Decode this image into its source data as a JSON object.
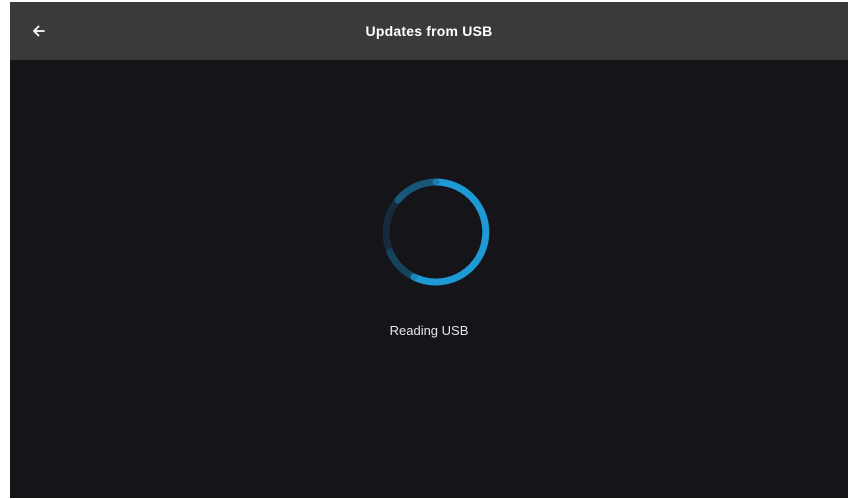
{
  "header": {
    "title": "Updates from USB",
    "back_icon": "arrow-left-icon"
  },
  "loading": {
    "status_text": "Reading USB",
    "spinner_icon": "loading-spinner-icon"
  },
  "colors": {
    "background": "#141419",
    "header": "#3a3a3a",
    "accent": "#1d9ad6",
    "text": "#ffffff"
  }
}
